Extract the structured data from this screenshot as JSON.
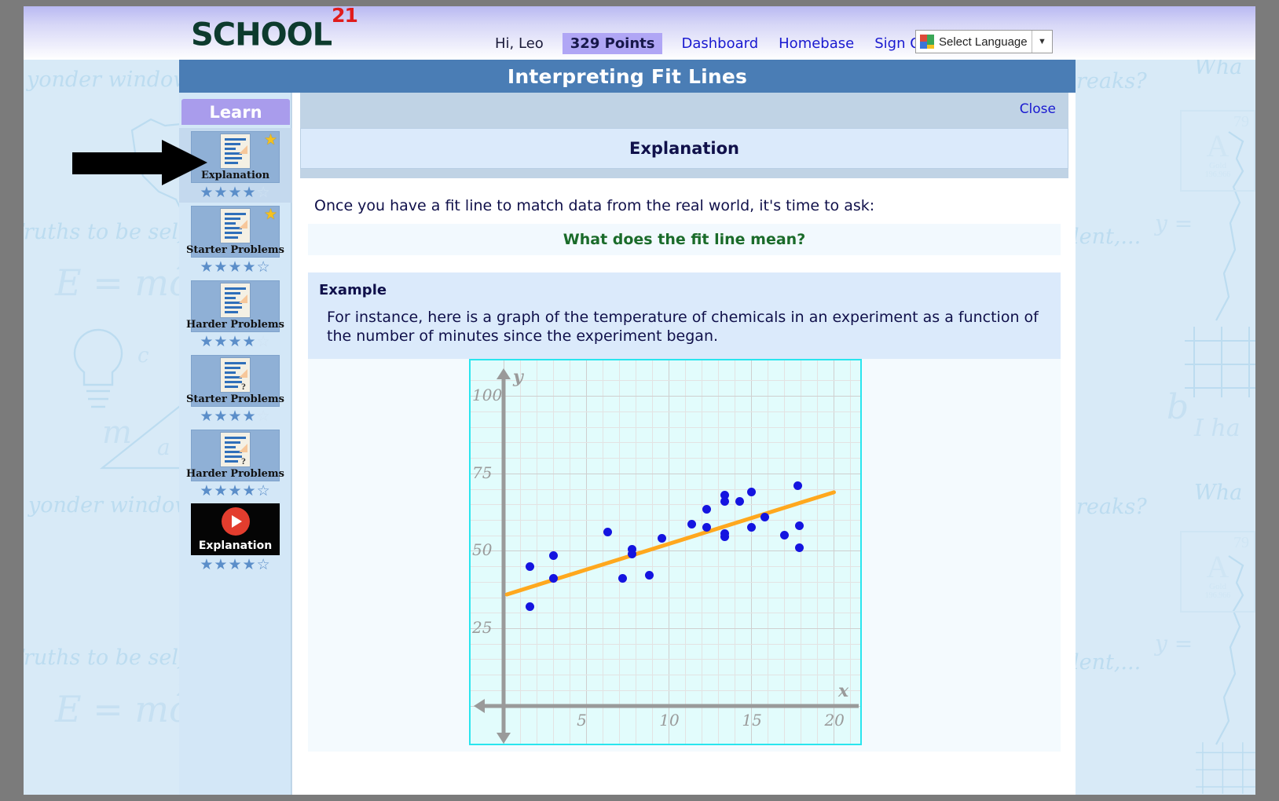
{
  "header": {
    "logo_text": "SCHOOL",
    "logo_sup": "21",
    "greeting": "Hi, Leo",
    "points": "329 Points",
    "links": [
      "Dashboard",
      "Homebase",
      "Sign Out"
    ],
    "language_label": "Select Language",
    "language_caret": "▼"
  },
  "title_bar": {
    "title": "Interpreting Fit Lines"
  },
  "sidebar": {
    "tab_label": "Learn",
    "items": [
      {
        "label": "Explanation",
        "icon": "document-icon",
        "stars_filled": 4,
        "stars_total": 5,
        "half": false,
        "gold_star": true,
        "selected": true,
        "type": "doc"
      },
      {
        "label": "Starter Problems",
        "icon": "document-icon",
        "stars_filled": 4,
        "stars_total": 5,
        "half": true,
        "gold_star": true,
        "selected": false,
        "type": "doc"
      },
      {
        "label": "Harder Problems",
        "icon": "document-icon",
        "stars_filled": 4,
        "stars_total": 5,
        "half": false,
        "gold_star": false,
        "selected": false,
        "type": "doc"
      },
      {
        "label": "Starter Problems",
        "icon": "document-question-icon",
        "stars_filled": 4,
        "stars_total": 5,
        "half": false,
        "gold_star": false,
        "selected": false,
        "type": "docq"
      },
      {
        "label": "Harder Problems",
        "icon": "document-question-icon",
        "stars_filled": 4,
        "stars_total": 5,
        "half": true,
        "gold_star": false,
        "selected": false,
        "type": "docq"
      },
      {
        "label": "Explanation",
        "icon": "play-icon",
        "stars_filled": 4,
        "stars_total": 5,
        "half": true,
        "gold_star": false,
        "selected": false,
        "type": "video"
      }
    ]
  },
  "main": {
    "close_label": "Close",
    "panel_heading": "Explanation",
    "intro_text": "Once you have a fit line to match data from the real world, it's time to ask:",
    "question_text": "What does the fit line mean?",
    "example_title": "Example",
    "example_text": "For instance, here is a graph of the temperature of chemicals in an experiment as a function of the number of minutes since the experiment began."
  },
  "colors": {
    "accent_blue": "#4a7db5",
    "purple": "#a99cec",
    "link_blue": "#1a1ad0",
    "green": "#1a6b2a",
    "point_blue": "#1414e0",
    "fit_line_orange": "#ffa81e",
    "chart_bg": "#e2fcfc",
    "chart_border": "#2ae5ee",
    "gold": "#f5c11e"
  },
  "chart_data": {
    "type": "scatter",
    "title": "",
    "xlabel": "x",
    "ylabel": "y",
    "xlim": [
      0,
      21.5
    ],
    "ylim": [
      0,
      108
    ],
    "xticks": [
      5,
      10,
      15,
      20
    ],
    "yticks": [
      25,
      50,
      75,
      100
    ],
    "grid": true,
    "points": [
      {
        "x": 1.6,
        "y": 45
      },
      {
        "x": 1.6,
        "y": 32
      },
      {
        "x": 3.0,
        "y": 48.5
      },
      {
        "x": 3.0,
        "y": 41
      },
      {
        "x": 6.3,
        "y": 56
      },
      {
        "x": 7.2,
        "y": 41
      },
      {
        "x": 7.8,
        "y": 50.5
      },
      {
        "x": 7.8,
        "y": 49
      },
      {
        "x": 8.8,
        "y": 42
      },
      {
        "x": 9.6,
        "y": 54
      },
      {
        "x": 11.4,
        "y": 58.5
      },
      {
        "x": 12.3,
        "y": 63.5
      },
      {
        "x": 12.3,
        "y": 57.5
      },
      {
        "x": 13.4,
        "y": 68
      },
      {
        "x": 13.4,
        "y": 66
      },
      {
        "x": 13.4,
        "y": 55.5
      },
      {
        "x": 13.4,
        "y": 54.5
      },
      {
        "x": 14.3,
        "y": 66
      },
      {
        "x": 15.0,
        "y": 57.5
      },
      {
        "x": 15.0,
        "y": 69
      },
      {
        "x": 15.8,
        "y": 61
      },
      {
        "x": 17.0,
        "y": 55
      },
      {
        "x": 17.8,
        "y": 71
      },
      {
        "x": 17.9,
        "y": 58
      },
      {
        "x": 17.9,
        "y": 51
      }
    ],
    "fit_line": {
      "x1": 0.2,
      "y1": 36,
      "x2": 20.0,
      "y2": 69,
      "color": "#ffa81e",
      "width": 5
    }
  }
}
